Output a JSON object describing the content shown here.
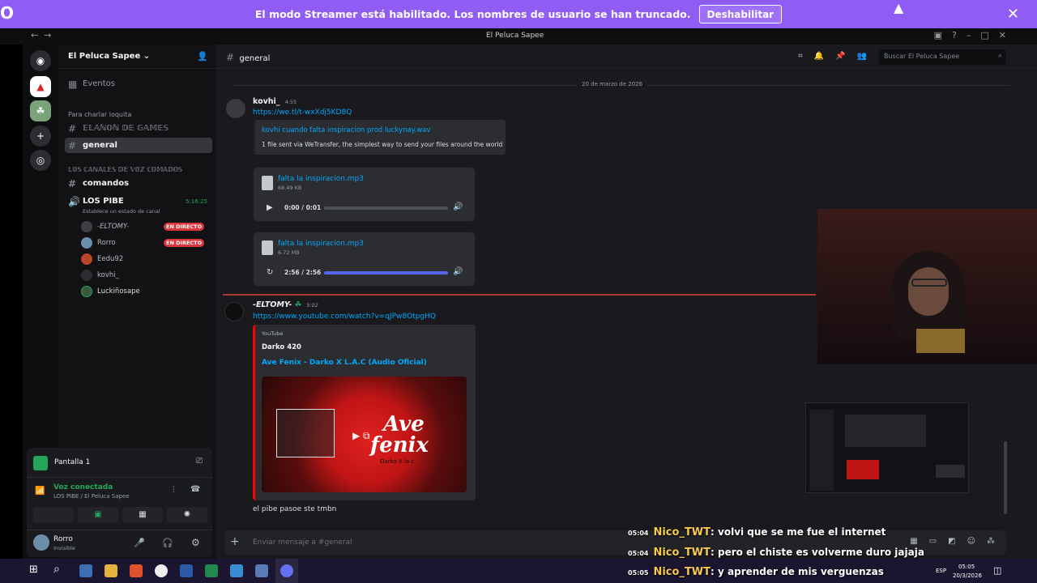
{
  "banner": {
    "logo": "O",
    "text": "El modo Streamer está habilitado. Los nombres de usuario se han truncado.",
    "button": "Deshabilitar",
    "close": "✕"
  },
  "window": {
    "title": "El Peluca Sapee"
  },
  "server": {
    "name": "El Peluca Sapee"
  },
  "channels": {
    "events": "Eventos",
    "category1": "Para charlar loquita",
    "list": [
      {
        "name": "𝔼𝕃𝔸ℕ𝕆ℕ 𝔻𝔼 𝔾𝔸𝕄𝔼𝕊"
      },
      {
        "name": "general"
      }
    ],
    "category2": "𝕃𝕆𝕊 ℂ𝔸ℕ𝔸𝕃𝔼𝕊 𝔻𝔼 𝕍𝕆ℤ ℂ𝕆𝕄𝔸𝔻𝕆𝕊",
    "commands": "comandos",
    "voice": {
      "name": "LOS PIBE",
      "time": "5:16:25",
      "status": "Establece un estado de canal"
    },
    "users": [
      {
        "name": "-ELTOMY-",
        "live": "EN DIRECTO"
      },
      {
        "name": "Rorro",
        "live": "EN DIRECTO"
      },
      {
        "name": "Eedu92",
        "live": ""
      },
      {
        "name": "kovhi_",
        "live": ""
      },
      {
        "name": "Luckiñosape",
        "live": ""
      }
    ]
  },
  "panel": {
    "screen": "Pantalla 1",
    "voice_status": "Voz conectada",
    "voice_location": "LOS PIBE / El Peluca Sapee",
    "user": "Rorro",
    "user_status": "Invisible"
  },
  "header": {
    "channel": "general",
    "search_placeholder": "Buscar El Peluca Sapee"
  },
  "messages": {
    "date": "20 de marzo de 2026",
    "m1": {
      "author": "kovhi_",
      "time": "4:55",
      "link": "https://we.tl/t-wxXdj5KD8Q",
      "embed_title": "kovhi cuando falta inspiracion prod luckynay.wav",
      "embed_desc": "1 file sent via WeTransfer, the simplest way to send your files around the world",
      "audio1": {
        "name": "falta la inspiracion.mp3",
        "size": "68.49 KB",
        "time": "0:00 / 0:01",
        "progress": 0
      },
      "audio2": {
        "name": "falta la inspiracion.mp3",
        "size": "6.72 MB",
        "time": "2:56 / 2:56",
        "progress": 1
      }
    },
    "m2": {
      "author": "-ELTOMY-",
      "time": "5:02",
      "link": "https://www.youtube.com/watch?v=qJPw8OtpgHQ",
      "provider": "YouTube",
      "embed_author": "Darko 420",
      "embed_title": "Ave Fenix - Darko X L.A.C (Audio Oficial)",
      "thumb_line1": "Ave",
      "thumb_line2": "fenix",
      "thumb_sub": "Darko X la c"
    },
    "m3": {
      "text": "el pibe pasoe ste tmbn"
    }
  },
  "composer": {
    "placeholder": "Enviar mensaje a #general"
  },
  "chat_overlay": [
    {
      "ts": "05:04",
      "nick": "Nico_TWT",
      "text": ": volvi que se me fue el internet"
    },
    {
      "ts": "05:04",
      "nick": "Nico_TWT",
      "text": ": pero el chiste es volverme duro jajaja"
    },
    {
      "ts": "05:05",
      "nick": "Nico_TWT",
      "text": ": y aprender de mis verguenzas"
    }
  ],
  "taskbar": {
    "lang": "ESP",
    "time": "05:05",
    "date": "20/3/2026"
  },
  "colors": {
    "accent": "#5865f2",
    "banner": "#8f5df3",
    "live": "#da373c",
    "link": "#00a8fc"
  }
}
